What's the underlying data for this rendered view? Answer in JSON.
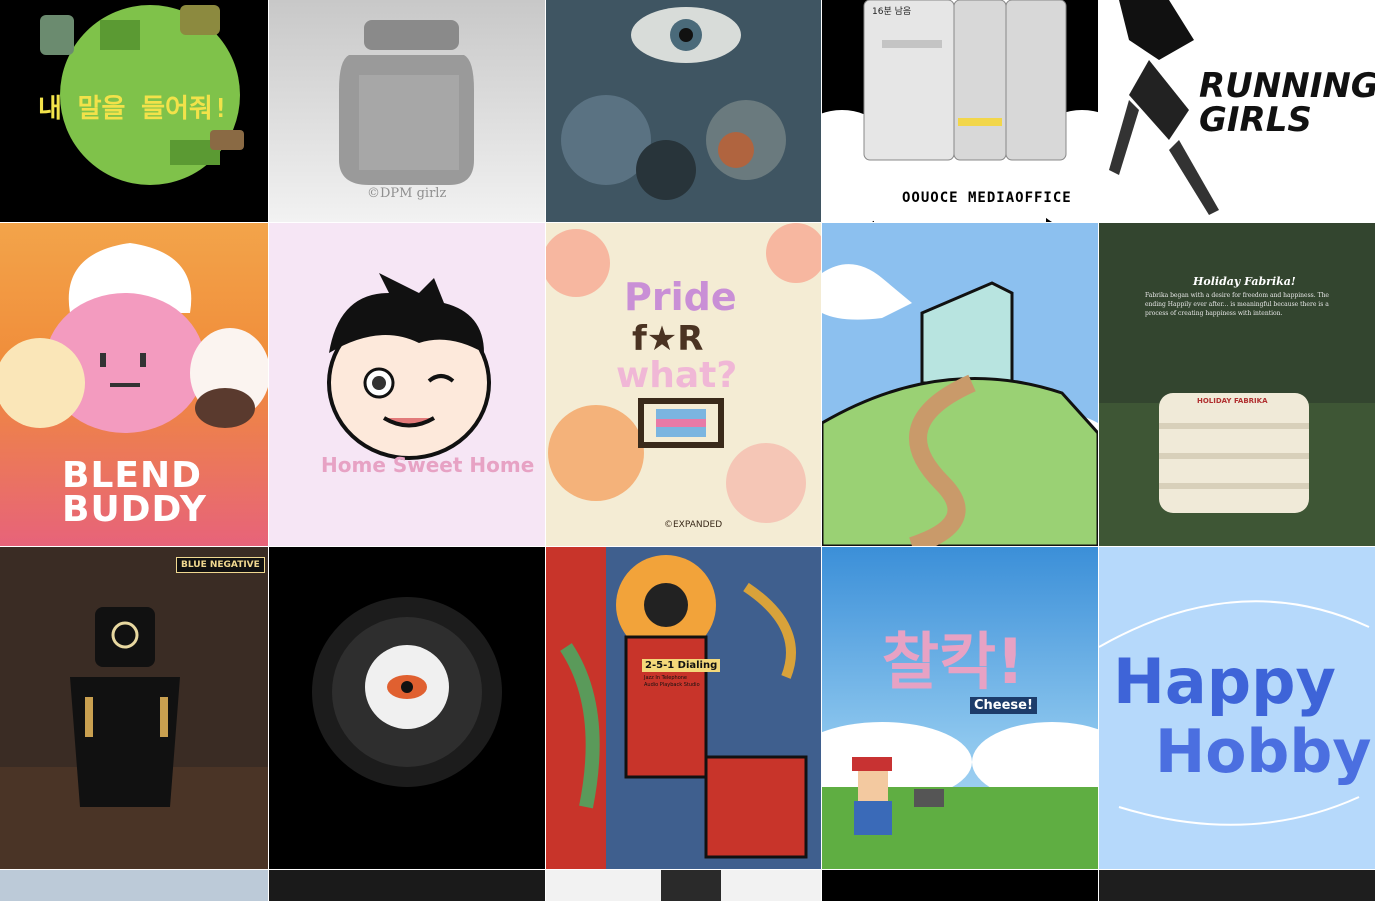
{
  "gallery": {
    "tiles": [
      {
        "text": "내 말을 들어줘!"
      },
      {
        "text": "©DPM girlz"
      },
      {
        "text": ""
      },
      {
        "top_text": "16분 남음",
        "bottom_text": "OOUOCE MEDIAOFFICE"
      },
      {
        "line1": "RUNNING",
        "line2": "GIRLS"
      },
      {
        "line1": "BLEND",
        "line2": "BUDDY"
      },
      {
        "text": "Home Sweet Home"
      },
      {
        "line1": "Pride",
        "line2": "f★R",
        "line3": "what?",
        "credit": "©EXPANDED"
      },
      {
        "text": ""
      },
      {
        "title": "Holiday Fabrika!",
        "body": "Fabrika began with a desire for freedom and happiness. The ending Happily ever after... is meaningful because there is a process of creating happiness with intention.",
        "towel_label": "HOLIDAY FABRIKA"
      },
      {
        "badge": "BLUE NEGATIVE"
      },
      {
        "text": ""
      },
      {
        "line1": "2-5-1 Dialing",
        "line2": "Jazz In Telephone Audio Playback Studio"
      },
      {
        "line1": "찰칵!",
        "line2": "Cheese!"
      },
      {
        "line1": "Happy",
        "line2": "Hobby"
      }
    ]
  },
  "colors": {
    "accent_yellow": "#f2e24a",
    "blend_orange": "#f08c3a",
    "happy_blue": "#3e64d8",
    "pink_title": "#e7a2c4"
  }
}
